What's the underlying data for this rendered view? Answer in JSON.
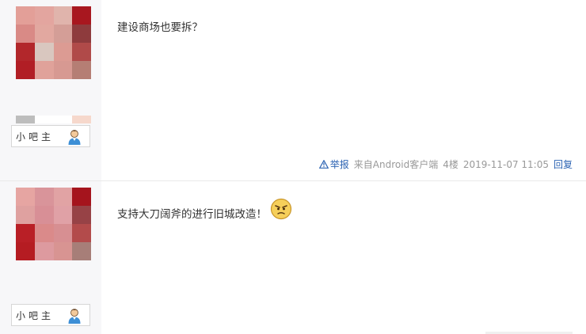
{
  "posts": [
    {
      "author_badge": "小吧主",
      "avatar_colors": [
        "#e39f98",
        "#e3a59f",
        "#e0b4ac",
        "#a8171f",
        "#d98a86",
        "#e2a8a0",
        "#d49e97",
        "#8e3b3d",
        "#b2272b",
        "#d9c7bf",
        "#dc9b93",
        "#b04a49",
        "#b11e25",
        "#e0a29a",
        "#d79992",
        "#b57e74"
      ],
      "content": "建设商场也要拆？",
      "tail": {
        "report": "举报",
        "source": "来自Android客户端",
        "floor": "4楼",
        "time": "2019-11-07 11:05",
        "reply": "回复"
      }
    },
    {
      "author_badge": "小吧主",
      "avatar_colors": [
        "#e6a5a2",
        "#d9949a",
        "#e1a3a4",
        "#a5141d",
        "#dfa1a0",
        "#d88f96",
        "#e0a1a6",
        "#974246",
        "#b91f26",
        "#da8a8a",
        "#d78f92",
        "#b34b4b",
        "#b51c22",
        "#dd9a9f",
        "#d89492",
        "#a77e78"
      ],
      "content": "支持大刀阔斧的进行旧城改造！"
    }
  ],
  "icons": {
    "user_icon": "user-avatar-icon",
    "warn_icon": "warning-triangle-icon",
    "emoji": "angry-face-emoji"
  }
}
